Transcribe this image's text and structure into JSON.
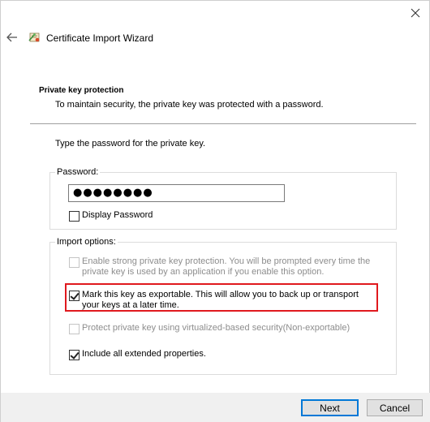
{
  "window": {
    "title": "Certificate Import Wizard",
    "icons": {
      "close": "close-icon",
      "back": "back-arrow-icon",
      "wizard": "certificate-wizard-icon"
    }
  },
  "page": {
    "section_title": "Private key protection",
    "section_desc": "To maintain security, the private key was protected with a password.",
    "prompt": "Type the password for the private key."
  },
  "password_group": {
    "legend": "Password:",
    "value": "●●●●●●●●",
    "display_password_label": "Display Password",
    "display_password_checked": false
  },
  "import_group": {
    "legend": "Import options:",
    "options": [
      {
        "label": "Enable strong private key protection. You will be prompted every time the private key is used by an application if you enable this option.",
        "checked": false,
        "enabled": false
      },
      {
        "label": "Mark this key as exportable. This will allow you to back up or transport your keys at a later time.",
        "checked": true,
        "enabled": true,
        "highlighted": true
      },
      {
        "label": "Protect private key using virtualized-based security(Non-exportable)",
        "checked": false,
        "enabled": false
      },
      {
        "label": "Include all extended properties.",
        "checked": true,
        "enabled": true
      }
    ]
  },
  "buttons": {
    "next": "Next",
    "cancel": "Cancel"
  },
  "colors": {
    "highlight": "#e0191e",
    "primary_border": "#0078d7",
    "footer": "#f0f0f0"
  }
}
